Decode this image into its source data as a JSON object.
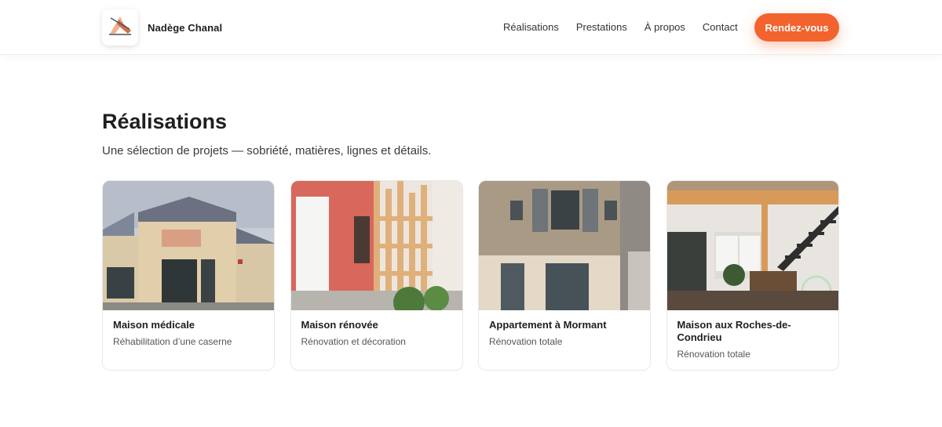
{
  "header": {
    "brand_name": "Nadège Chanal",
    "logo_text": "Nadège Chanal",
    "nav": [
      "Réalisations",
      "Prestations",
      "À propos",
      "Contact"
    ],
    "cta_label": "Rendez-vous",
    "accent_color": "#f2632e"
  },
  "section": {
    "title": "Réalisations",
    "subtitle": "Une sélection de projets — sobriété, matières, lignes et détails."
  },
  "projects": [
    {
      "title": "Maison médicale",
      "subtitle": "Réhabilitation d’une caserne"
    },
    {
      "title": "Maison rénovée",
      "subtitle": "Rénovation et décoration"
    },
    {
      "title": "Appartement à Mormant",
      "subtitle": "Rénovation totale"
    },
    {
      "title": "Maison aux Roches-de-Condrieu",
      "subtitle": "Rénovation totale"
    }
  ]
}
